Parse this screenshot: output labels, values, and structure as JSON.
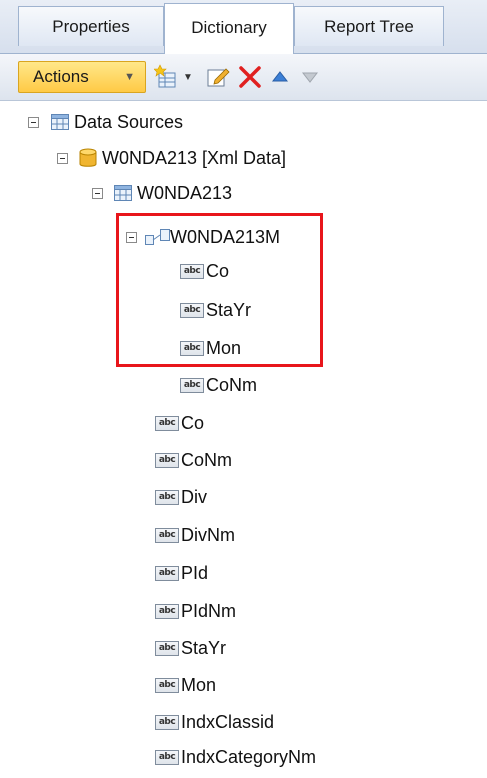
{
  "tabs": {
    "properties": "Properties",
    "dictionary": "Dictionary",
    "report_tree": "Report Tree"
  },
  "toolbar": {
    "actions_label": "Actions"
  },
  "tree": {
    "data_sources": "Data Sources",
    "datasource": "W0NDA213 [Xml Data]",
    "table": "W0NDA213",
    "relation": "W0NDA213M",
    "relation_columns": [
      "Co",
      "StaYr",
      "Mon",
      "CoNm"
    ],
    "columns": [
      "Co",
      "CoNm",
      "Div",
      "DivNm",
      "PId",
      "PIdNm",
      "StaYr",
      "Mon",
      "IndxClassid",
      "IndxCategoryNm"
    ],
    "abc_icon_text": "abc"
  },
  "colors": {
    "highlight": "#e8151b",
    "actions_button": "#ffca45"
  }
}
